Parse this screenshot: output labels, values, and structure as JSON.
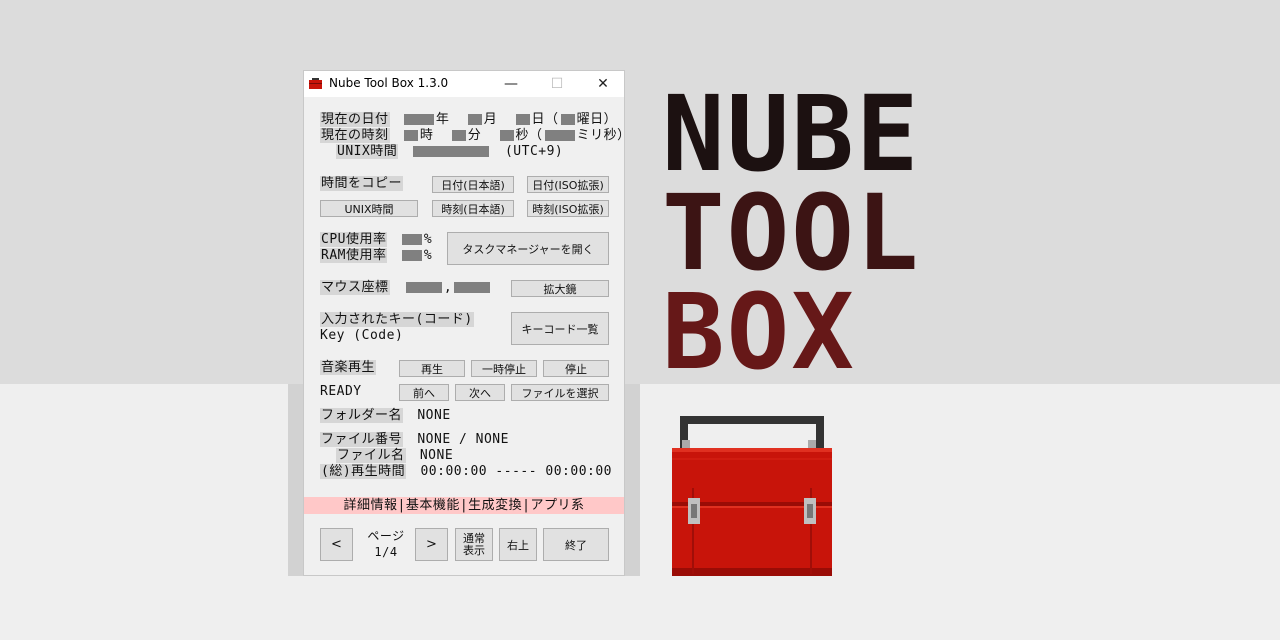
{
  "window": {
    "title": "Nube Tool Box 1.3.0",
    "minimize": "—",
    "maximize": "☐",
    "close": "✕"
  },
  "date": {
    "label": "現在の日付",
    "year": "年",
    "month": "月",
    "day": "日",
    "weekday_open": "（",
    "weekday": "曜日）"
  },
  "time": {
    "label": "現在の時刻",
    "hour": "時",
    "minute": "分",
    "second": "秒",
    "ms_open": "（",
    "ms": "ミリ秒）"
  },
  "unix": {
    "label": "UNIX時間",
    "tz": "(UTC+9)"
  },
  "copy": {
    "label": "時間をコピー",
    "date_jp": "日付(日本語)",
    "date_iso": "日付(ISO拡張)",
    "unix": "UNIX時間",
    "time_jp": "時刻(日本語)",
    "time_iso": "時刻(ISO拡張)"
  },
  "system": {
    "cpu_label": "CPU使用率",
    "ram_label": "RAM使用率",
    "percent": "%",
    "task_manager": "タスクマネージャーを開く"
  },
  "mouse": {
    "label": "マウス座標",
    "comma": ",",
    "magnifier": "拡大鏡"
  },
  "key": {
    "label": "入力されたキー(コード)",
    "value": "Key (Code)",
    "keycode_list": "キーコード一覧"
  },
  "music": {
    "label": "音楽再生",
    "play": "再生",
    "pause": "一時停止",
    "stop": "停止",
    "status": "READY",
    "prev": "前へ",
    "next": "次へ",
    "select_file": "ファイルを選択",
    "folder_label": "フォルダー名",
    "folder_value": "NONE",
    "file_no_label": "ファイル番号",
    "file_no_value": "NONE / NONE",
    "file_name_label": "ファイル名",
    "file_name_value": "NONE",
    "total_time_label": "(総)再生時間",
    "total_time_value": "00:00:00 ----- 00:00:00"
  },
  "tabs": {
    "text": "詳細情報|基本機能|生成変換|アプリ系"
  },
  "footer": {
    "prev": "<",
    "page_label": "ページ",
    "page_value": "1/4",
    "next": ">",
    "normal_view_1": "通常",
    "normal_view_2": "表示",
    "top_right": "右上",
    "exit": "終了"
  },
  "logo": {
    "line1": "NUBE",
    "line2": "TOOL",
    "line3": "BOX"
  },
  "colors": {
    "accent": "#ffc8c8",
    "toolbox_red": "#c8140a"
  }
}
